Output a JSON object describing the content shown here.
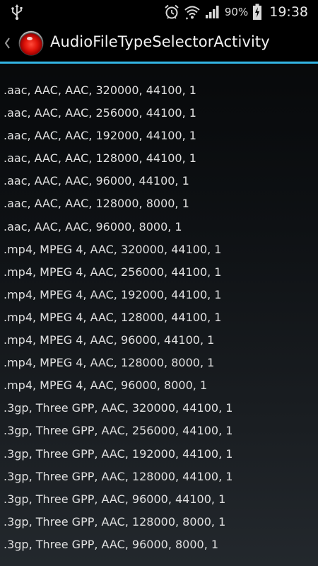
{
  "status_bar": {
    "battery_percent": "90%",
    "time": "19:38",
    "icons": [
      "usb-icon",
      "alarm-icon",
      "wifi-icon",
      "signal-icon",
      "battery-charging-icon"
    ]
  },
  "action_bar": {
    "title": "AudioFileTypeSelectorActivity",
    "accent_color": "#33b5e5"
  },
  "list": {
    "items": [
      ".aac, AAC, AAC, 320000, 44100, 1",
      ".aac, AAC, AAC, 256000, 44100, 1",
      ".aac, AAC, AAC, 192000, 44100, 1",
      ".aac, AAC, AAC, 128000, 44100, 1",
      ".aac, AAC, AAC, 96000, 44100, 1",
      ".aac, AAC, AAC, 128000, 8000, 1",
      ".aac, AAC, AAC, 96000, 8000, 1",
      ".mp4, MPEG 4, AAC, 320000, 44100, 1",
      ".mp4, MPEG 4, AAC, 256000, 44100, 1",
      ".mp4, MPEG 4, AAC, 192000, 44100, 1",
      ".mp4, MPEG 4, AAC, 128000, 44100, 1",
      ".mp4, MPEG 4, AAC, 96000, 44100, 1",
      ".mp4, MPEG 4, AAC, 128000, 8000, 1",
      ".mp4, MPEG 4, AAC, 96000, 8000, 1",
      ".3gp, Three GPP, AAC, 320000, 44100, 1",
      ".3gp, Three GPP, AAC, 256000, 44100, 1",
      ".3gp, Three GPP, AAC, 192000, 44100, 1",
      ".3gp, Three GPP, AAC, 128000, 44100, 1",
      ".3gp, Three GPP, AAC, 96000, 44100, 1",
      ".3gp, Three GPP, AAC, 128000, 8000, 1",
      ".3gp, Three GPP, AAC, 96000, 8000, 1"
    ]
  }
}
